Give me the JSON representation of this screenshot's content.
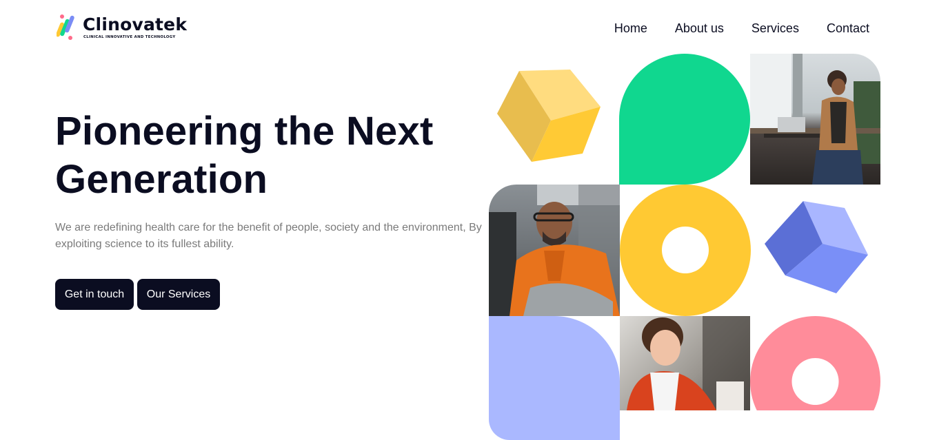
{
  "brand": {
    "name": "Clinovatek",
    "tagline": "CLINICAL INNOVATIVE AND TECHNOLOGY"
  },
  "nav": {
    "items": [
      "Home",
      "About us",
      "Services",
      "Contact"
    ]
  },
  "hero": {
    "title_line1": "Pioneering the Next",
    "title_line2": "Generation",
    "subtitle": "We are redefining health care for the benefit of people, society and the environment, By exploiting science to its fullest ability.",
    "primary_button": "Get in touch",
    "secondary_button": "Our Services"
  },
  "colors": {
    "dark": "#0b0d21",
    "muted_text": "#7a7a7a",
    "green": "#10d78f",
    "yellow": "#ffc933",
    "periwinkle": "#aab8ff",
    "blue_cube": "#6f86f0",
    "pink": "#ff8c9a"
  },
  "icons": {
    "logo": "clinovatek-logo-mark"
  },
  "collage": {
    "photos": [
      "woman-at-laptop-photo",
      "man-with-glasses-photo",
      "smiling-woman-photo"
    ]
  }
}
